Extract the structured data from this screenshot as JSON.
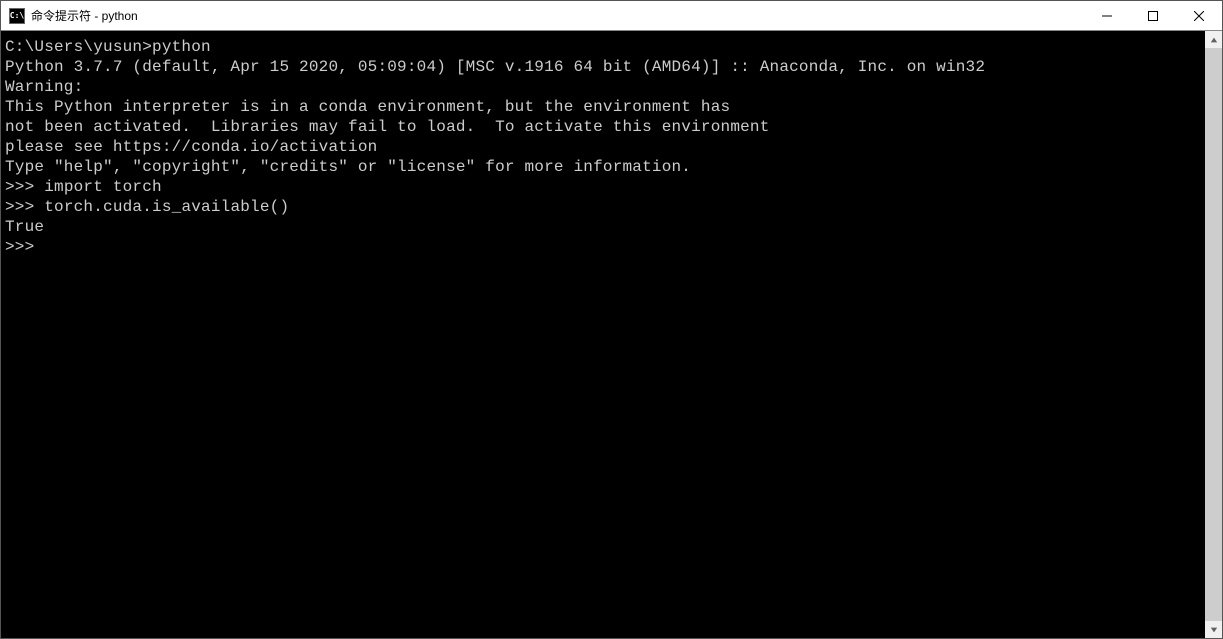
{
  "window": {
    "icon_text": "C:\\",
    "title": "命令提示符 - python"
  },
  "terminal": {
    "blank0": "",
    "cmdline": "C:\\Users\\yusun>python",
    "version": "Python 3.7.7 (default, Apr 15 2020, 05:09:04) [MSC v.1916 64 bit (AMD64)] :: Anaconda, Inc. on win32",
    "blank1": "",
    "warn0": "Warning:",
    "warn1": "This Python interpreter is in a conda environment, but the environment has",
    "warn2": "not been activated.  Libraries may fail to load.  To activate this environment",
    "warn3": "please see https://conda.io/activation",
    "blank2": "",
    "help": "Type \"help\", \"copyright\", \"credits\" or \"license\" for more information.",
    "p1": ">>> ",
    "in1": "import torch",
    "p2": ">>> ",
    "in2": "torch.cuda.is_available()",
    "out1": "True",
    "p3": ">>> "
  }
}
